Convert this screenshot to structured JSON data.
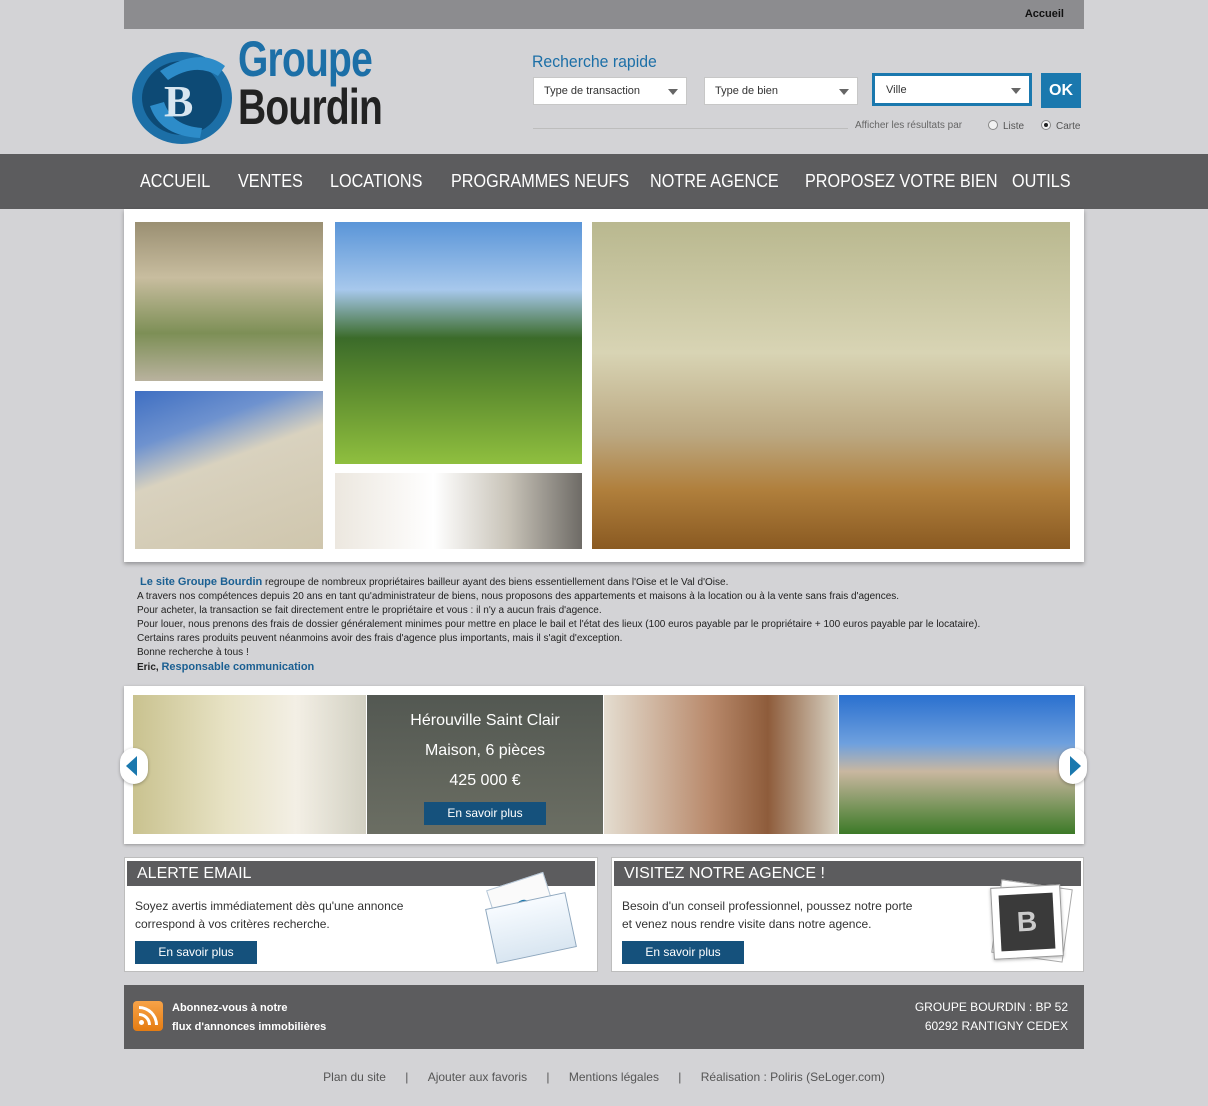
{
  "topbar": {
    "home_link": "Accueil"
  },
  "logo": {
    "line1": "Groupe",
    "line2": "Bourdin"
  },
  "quick_search": {
    "title": "Recherche rapide",
    "transaction_type": "Type de transaction",
    "property_type": "Type de bien",
    "city": "Ville",
    "ok_label": "OK",
    "display_label": "Afficher les résultats par",
    "option_list": "Liste",
    "option_map": "Carte",
    "selected_option": "Carte"
  },
  "nav": {
    "items": [
      "ACCUEIL",
      "VENTES",
      "LOCATIONS",
      "PROGRAMMES NEUFS",
      "NOTRE AGENCE",
      "PROPOSEZ VOTRE BIEN",
      "OUTILS"
    ]
  },
  "intro": {
    "highlight": "Le site Groupe Bourdin",
    "line1_rest": " regroupe de nombreux propriétaires bailleur ayant des biens essentiellement dans l'Oise et le Val d'Oise.",
    "line2": "A travers nos compétences depuis 20 ans en tant qu'administrateur de biens, nous proposons des appartements et maisons à la location ou à la vente sans frais d'agences.",
    "line3": "Pour acheter, la transaction se fait directement entre le propriétaire et vous : il n'y a aucun frais d'agence.",
    "line4": "Pour louer, nous prenons des frais de dossier généralement minimes pour mettre en place le bail et l'état des lieux (100 euros payable par le propriétaire + 100 euros payable par le locataire).",
    "line5": "Certains rares produits peuvent néanmoins avoir des frais d'agence plus importants, mais il s'agit d'exception.",
    "line6": "Bonne recherche à tous !",
    "signature_name": "Eric,",
    "signature_role": "Responsable communication"
  },
  "carousel": {
    "city": "Hérouville Saint Clair",
    "type": "Maison, 6 pièces",
    "price": "425 000 €",
    "button": "En savoir plus"
  },
  "alert_box": {
    "title": "ALERTE EMAIL",
    "text": "Soyez avertis immédiatement dès qu'une annonce correspond à vos critères recherche.",
    "button": "En savoir plus"
  },
  "visit_box": {
    "title": "VISITEZ NOTRE AGENCE !",
    "text": "Besoin d'un conseil professionnel, poussez notre porte et venez nous rendre visite dans notre agence.",
    "button": "En savoir plus"
  },
  "footer": {
    "rss_line1": "Abonnez-vous à notre",
    "rss_line2": "flux d'annonces immobilières",
    "address_line1": "GROUPE BOURDIN : BP 52",
    "address_line2": "60292 RANTIGNY CEDEX"
  },
  "bottom_links": {
    "sitemap": "Plan du site",
    "favorites": "Ajouter aux favoris",
    "legal": "Mentions légales",
    "credits": "Réalisation : Poliris (SeLoger.com)",
    "separator": "|"
  },
  "colors": {
    "accent": "#1a78ae",
    "nav": "#5c5c5e",
    "button": "#15517c"
  },
  "icons": [
    "envelope-icon",
    "rss-icon",
    "photo-badge-icon",
    "arrow-left-icon",
    "arrow-right-icon",
    "logo-emblem-icon"
  ]
}
